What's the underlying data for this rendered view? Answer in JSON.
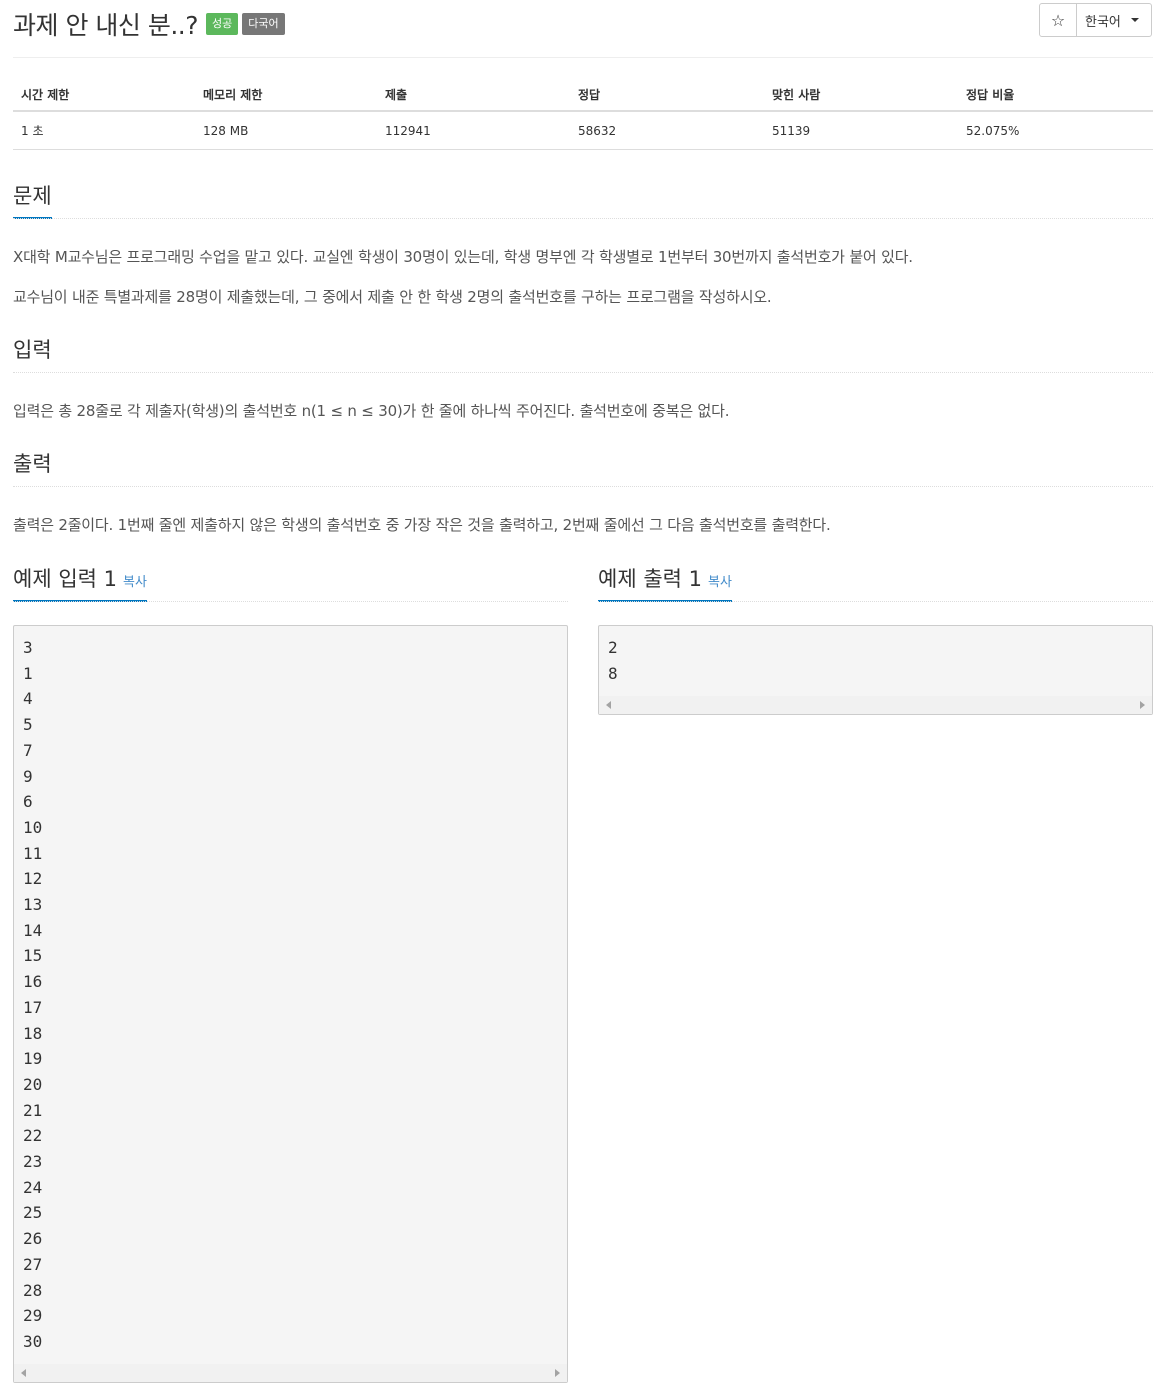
{
  "problem": {
    "title": "과제 안 내신 분..?",
    "badges": {
      "success": "성공",
      "multilang": "다국어"
    }
  },
  "toolbar": {
    "star_icon": "☆",
    "language": "한국어"
  },
  "info_table": {
    "headers": [
      "시간 제한",
      "메모리 제한",
      "제출",
      "정답",
      "맞힌 사람",
      "정답 비율"
    ],
    "values": [
      "1 초",
      "128 MB",
      "112941",
      "58632",
      "51139",
      "52.075%"
    ]
  },
  "sections": {
    "problem": {
      "heading": "문제",
      "paragraphs": [
        "X대학 M교수님은 프로그래밍 수업을 맡고 있다. 교실엔 학생이 30명이 있는데, 학생 명부엔 각 학생별로 1번부터 30번까지 출석번호가 붙어 있다.",
        "교수님이 내준 특별과제를 28명이 제출했는데, 그 중에서 제출 안 한 학생 2명의 출석번호를 구하는 프로그램을 작성하시오."
      ]
    },
    "input": {
      "heading": "입력",
      "text": "입력은 총 28줄로 각 제출자(학생)의 출석번호 n(1 ≤ n ≤ 30)가 한 줄에 하나씩 주어진다. 출석번호에 중복은 없다."
    },
    "output": {
      "heading": "출력",
      "text": "출력은 2줄이다. 1번째 줄엔 제출하지 않은 학생의 출석번호 중 가장 작은 것을 출력하고, 2번째 줄에선 그 다음 출석번호를 출력한다."
    }
  },
  "samples": {
    "input": {
      "heading": "예제 입력 1",
      "copy": "복사",
      "content": "3\n1\n4\n5\n7\n9\n6\n10\n11\n12\n13\n14\n15\n16\n17\n18\n19\n20\n21\n22\n23\n24\n25\n26\n27\n28\n29\n30"
    },
    "output": {
      "heading": "예제 출력 1",
      "copy": "복사",
      "content": "2\n8"
    }
  }
}
